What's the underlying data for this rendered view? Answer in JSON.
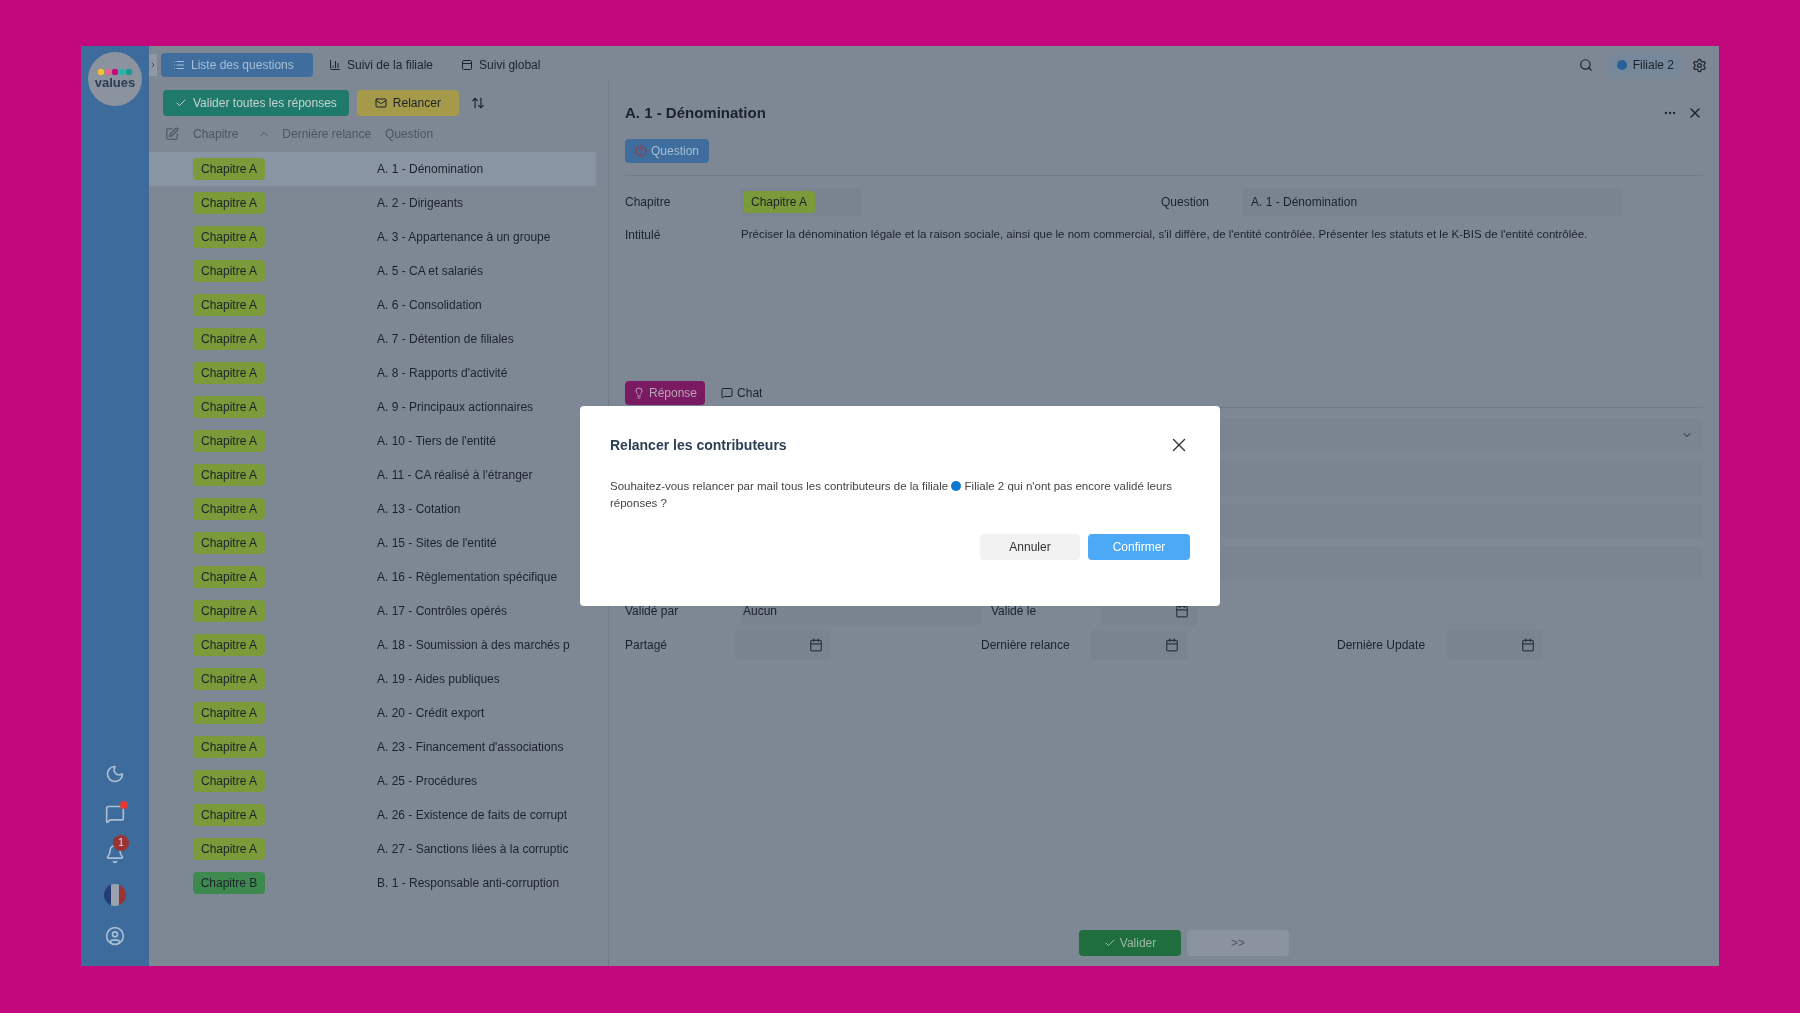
{
  "nav_tabs": [
    {
      "label": "Liste des questions",
      "selected": true,
      "kind": "list"
    },
    {
      "label": "Suivi de la filiale",
      "selected": false,
      "kind": "bars"
    },
    {
      "label": "Suivi global",
      "selected": false,
      "kind": "panel"
    }
  ],
  "filiale_chip": {
    "label": "Filiale 2",
    "color": "#2a6098"
  },
  "toolbar": {
    "validate_all": "Valider toutes les réponses",
    "remind": "Relancer"
  },
  "list_columns": [
    "Chapitre",
    "Dernière relance",
    "Question"
  ],
  "rows": [
    {
      "chapter": "Chapitre A",
      "question": "A. 1 - Dénomination",
      "selected": true,
      "color": "#7b9a3a"
    },
    {
      "chapter": "Chapitre A",
      "question": "A. 2 - Dirigeants",
      "selected": false,
      "color": "#7b9a3a"
    },
    {
      "chapter": "Chapitre A",
      "question": "A. 3 - Appartenance à un groupe",
      "selected": false,
      "color": "#7b9a3a"
    },
    {
      "chapter": "Chapitre A",
      "question": "A. 5 - CA et salariés",
      "selected": false,
      "color": "#7b9a3a"
    },
    {
      "chapter": "Chapitre A",
      "question": "A. 6 - Consolidation",
      "selected": false,
      "color": "#7b9a3a"
    },
    {
      "chapter": "Chapitre A",
      "question": "A. 7 - Détention de filiales",
      "selected": false,
      "color": "#7b9a3a"
    },
    {
      "chapter": "Chapitre A",
      "question": "A. 8 - Rapports d'activité",
      "selected": false,
      "color": "#7b9a3a"
    },
    {
      "chapter": "Chapitre A",
      "question": "A. 9 - Principaux actionnaires",
      "selected": false,
      "color": "#7b9a3a"
    },
    {
      "chapter": "Chapitre A",
      "question": "A. 10 - Tiers de l'entité",
      "selected": false,
      "color": "#7b9a3a"
    },
    {
      "chapter": "Chapitre A",
      "question": "A. 11 - CA réalisé à l'étranger",
      "selected": false,
      "color": "#7b9a3a"
    },
    {
      "chapter": "Chapitre A",
      "question": "A. 13 - Cotation",
      "selected": false,
      "color": "#7b9a3a"
    },
    {
      "chapter": "Chapitre A",
      "question": "A. 15 - Sites de l'entité",
      "selected": false,
      "color": "#7b9a3a"
    },
    {
      "chapter": "Chapitre A",
      "question": "A. 16 - Règlementation spécifique",
      "selected": false,
      "color": "#7b9a3a"
    },
    {
      "chapter": "Chapitre A",
      "question": "A. 17 - Contrôles opérés",
      "selected": false,
      "color": "#7b9a3a"
    },
    {
      "chapter": "Chapitre A",
      "question": "A. 18 - Soumission à des marchés p",
      "selected": false,
      "color": "#7b9a3a"
    },
    {
      "chapter": "Chapitre A",
      "question": "A. 19 - Aides publiques",
      "selected": false,
      "color": "#7b9a3a"
    },
    {
      "chapter": "Chapitre A",
      "question": "A. 20 - Crédit export",
      "selected": false,
      "color": "#7b9a3a"
    },
    {
      "chapter": "Chapitre A",
      "question": "A. 23 - Financement d'associations",
      "selected": false,
      "color": "#7b9a3a"
    },
    {
      "chapter": "Chapitre A",
      "question": "A. 25 - Procédures",
      "selected": false,
      "color": "#7b9a3a"
    },
    {
      "chapter": "Chapitre A",
      "question": "A. 26 - Existence de faits de corrupt",
      "selected": false,
      "color": "#7b9a3a"
    },
    {
      "chapter": "Chapitre A",
      "question": "A. 27 - Sanctions liées à la corruptic",
      "selected": false,
      "color": "#7b9a3a"
    },
    {
      "chapter": "Chapitre B",
      "question": "B. 1 - Responsable anti-corruption",
      "selected": false,
      "color": "#3e8a4e"
    }
  ],
  "sidebar": {
    "logo_text": "values",
    "bell_badge": "1"
  },
  "detail": {
    "title": "A. 1 - Dénomination",
    "question_tab": "Question",
    "chapter_label": "Chapitre",
    "chapter_value": "Chapitre A",
    "question_label": "Question",
    "question_value": "A. 1 - Dénomination",
    "intitule_label": "Intitulé",
    "intitule": "Préciser la dénomination légale et la raison sociale, ainsi que le nom commercial, s'il diffère, de l'entité contrôlée. Présenter les statuts et le K-BIS de l'entité contrôlée.",
    "answer_tabs": [
      {
        "label": "Réponse",
        "selected": true,
        "kind": "bulb"
      },
      {
        "label": "Chat",
        "selected": false,
        "kind": "chat"
      }
    ],
    "validated_by_label": "Validé par",
    "validated_by": "Aucun",
    "validated_on_label": "Validé le",
    "shared_label": "Partagé",
    "last_reminder_label": "Dernière relance",
    "last_update_label": "Dernière Update",
    "validate_button": "Valider",
    "next_button": ">>"
  },
  "dialog": {
    "title": "Relancer les contributeurs",
    "text_before": "Souhaitez-vous relancer par mail tous les contributeurs de la filiale",
    "filiale": {
      "label": "Filiale 2",
      "color": "#0a77d0"
    },
    "text_after": "qui n'ont pas encore validé leurs réponses ?",
    "cancel": "Annuler",
    "confirm": "Confirmer"
  }
}
